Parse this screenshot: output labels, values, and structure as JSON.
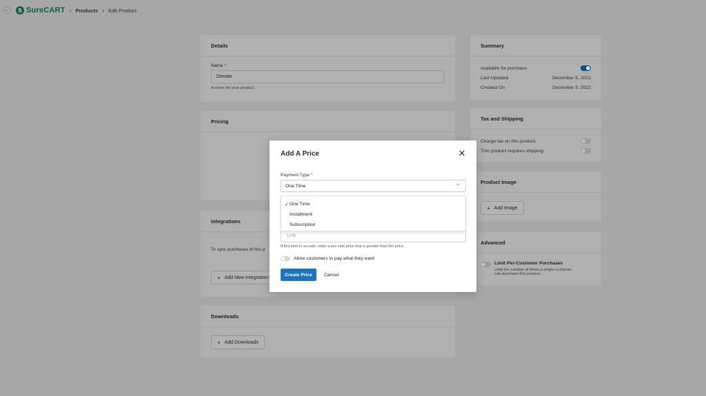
{
  "breadcrumb": {
    "back_glyph": "←",
    "logo_mark": "S",
    "logo_text": "SureCART",
    "sep": "›",
    "items": [
      "Products",
      "Edit Product"
    ]
  },
  "details": {
    "title": "Details",
    "name_label": "Name",
    "required_mark": "*",
    "name_value": "Donate",
    "name_help": "A name for your product."
  },
  "pricing": {
    "title": "Pricing"
  },
  "integrations": {
    "title": "Integrations",
    "text": "To sync purchases of this p",
    "button": "Add New Integration"
  },
  "downloads": {
    "title": "Downloads",
    "button": "Add Downloads"
  },
  "summary": {
    "title": "Summary",
    "available_label": "Available for purchase",
    "available_on": true,
    "last_updated_label": "Last Updated",
    "last_updated_value": "December 5, 2022",
    "created_label": "Created On",
    "created_value": "December 5, 2022"
  },
  "tax": {
    "title": "Tax and Shipping",
    "charge_tax": "Charge tax on this product",
    "requires_shipping": "This product requires shipping"
  },
  "product_image": {
    "title": "Product Image",
    "button": "Add Image"
  },
  "advanced": {
    "title": "Advanced",
    "limit_label": "Limit Per-Customer Purchases",
    "limit_help_1": "Limit the number of times a single customer",
    "limit_help_2": "can purchase this product."
  },
  "modal": {
    "title": "Add A Price",
    "close_glyph": "✕",
    "payment_type_label": "Payment Type",
    "required_mark": "*",
    "selected": "One Time",
    "chevron": "⌃",
    "options": [
      "One Time",
      "Installment",
      "Subscription"
    ],
    "check_glyph": "✓",
    "currency_placeholder": "US$",
    "sale_help": "If this item is on sale, enter a pre-sale price that is greater than the price.",
    "pay_what_want": "Allow customers to pay what they want",
    "create_button": "Create Price",
    "cancel_button": "Cancel"
  },
  "colors": {
    "primary": "#1e73be",
    "overlay": "#a7a7a7",
    "brand": "#0f5f3d"
  }
}
